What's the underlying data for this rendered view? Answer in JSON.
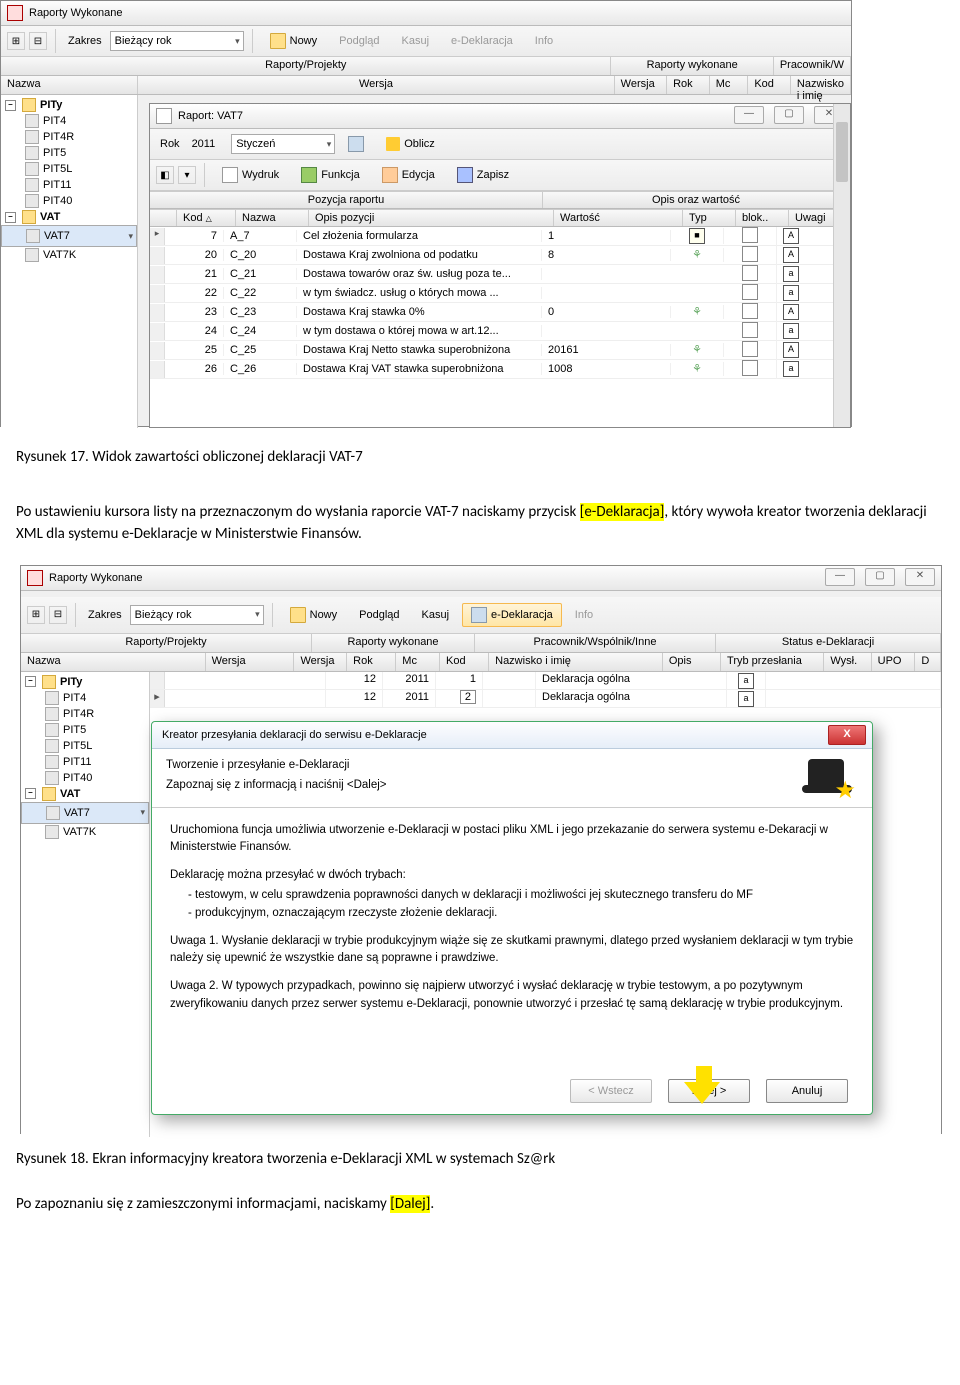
{
  "fig17": {
    "win_title": "Raporty Wykonane",
    "toolbar": {
      "zakres_label": "Zakres",
      "zakres_value": "Bieżący rok",
      "nowy": "Nowy",
      "podglad": "Podgląd",
      "kasuj": "Kasuj",
      "edekl": "e-Deklaracja",
      "info": "Info"
    },
    "header_groups": {
      "left": "Raporty/Projekty",
      "mid": "Raporty wykonane",
      "right": "Pracownik/W"
    },
    "header_cols": {
      "nazwa": "Nazwa",
      "wersja": "Wersja",
      "wersja2": "Wersja",
      "rok": "Rok",
      "mc": "Mc",
      "kod": "Kod",
      "nazwisko": "Nazwisko i imię"
    },
    "tree": {
      "pity": "PITy",
      "pit4": "PIT4",
      "pit4r": "PIT4R",
      "pit5": "PIT5",
      "pit5l": "PIT5L",
      "pit11": "PIT11",
      "pit40": "PIT40",
      "vat": "VAT",
      "vat7": "VAT7",
      "vat7k": "VAT7K"
    },
    "subwin": {
      "title": "Raport: VAT7",
      "rok_label": "Rok",
      "rok_value": "2011",
      "month": "Styczeń",
      "oblicz": "Oblicz",
      "wydruk": "Wydruk",
      "funkcja": "Funkcja",
      "edycja": "Edycja",
      "zapisz": "Zapisz",
      "group_left": "Pozycja raportu",
      "group_right": "Opis oraz wartość",
      "cols": {
        "kod": "Kod",
        "nazwa": "Nazwa",
        "opis": "Opis pozycji",
        "wartosc": "Wartość",
        "typ": "Typ",
        "blok": "blok..",
        "uwagi": "Uwagi"
      },
      "rows": [
        {
          "kod": "7",
          "nazwa": "A_7",
          "opis": "Cel złożenia formularza",
          "wartosc": "1",
          "typ": "doc",
          "a": "A"
        },
        {
          "kod": "20",
          "nazwa": "C_20",
          "opis": "Dostawa Kraj zwolniona od podatku",
          "wartosc": "8",
          "typ": "tree",
          "a": "A"
        },
        {
          "kod": "21",
          "nazwa": "C_21",
          "opis": "Dostawa towarów oraz św. usług poza te...",
          "wartosc": "",
          "typ": "",
          "a": "a"
        },
        {
          "kod": "22",
          "nazwa": "C_22",
          "opis": "   w tym świadcz. usług o których mowa ...",
          "wartosc": "",
          "typ": "",
          "a": "a"
        },
        {
          "kod": "23",
          "nazwa": "C_23",
          "opis": "Dostawa Kraj stawka 0%",
          "wartosc": "0",
          "typ": "tree",
          "a": "A"
        },
        {
          "kod": "24",
          "nazwa": "C_24",
          "opis": "   w tym dostawa o której mowa w art.12...",
          "wartosc": "",
          "typ": "",
          "a": "a"
        },
        {
          "kod": "25",
          "nazwa": "C_25",
          "opis": "Dostawa Kraj Netto stawka superobniżona",
          "wartosc": "20161",
          "typ": "tree",
          "a": "A"
        },
        {
          "kod": "26",
          "nazwa": "C_26",
          "opis": "Dostawa Kraj VAT stawka superobniżona",
          "wartosc": "1008",
          "typ": "tree",
          "a": "a"
        }
      ]
    }
  },
  "caption17": "Rysunek 17. Widok zawartości obliczonej deklaracji VAT-7",
  "para1_a": "Po ustawieniu kursora listy na przeznaczonym do wysłania raporcie VAT-7 naciskamy przycisk ",
  "para1_hl": "[e-Deklaracja]",
  "para1_b": ", który wywoła kreator tworzenia deklaracji XML dla systemu e-Deklaracje w Ministerstwie Finansów.",
  "fig18": {
    "win_title": "Raporty Wykonane",
    "toolbar": {
      "zakres_label": "Zakres",
      "zakres_value": "Bieżący rok",
      "nowy": "Nowy",
      "podglad": "Podgląd",
      "kasuj": "Kasuj",
      "edekl": "e-Deklaracja",
      "info": "Info"
    },
    "header_groups": {
      "g1": "Raporty/Projekty",
      "g2": "Raporty wykonane",
      "g3": "Pracownik/Wspólnik/Inne",
      "g4": "Status e-Deklaracji"
    },
    "header_cols": {
      "nazwa": "Nazwa",
      "wersja": "Wersja",
      "wersja2": "Wersja",
      "rok": "Rok",
      "mc": "Mc",
      "kod": "Kod",
      "nazwisko": "Nazwisko i imię",
      "opis": "Opis",
      "tryb": "Tryb przesłania",
      "wysl": "Wysł.",
      "upo": "UPO",
      "d": "D"
    },
    "tree": {
      "pity": "PITy",
      "pit4": "PIT4",
      "pit4r": "PIT4R",
      "pit5": "PIT5",
      "pit5l": "PIT5L",
      "pit11": "PIT11",
      "pit40": "PIT40",
      "vat": "VAT",
      "vat7": "VAT7",
      "vat7k": "VAT7K"
    },
    "rows": [
      {
        "wersja": "12",
        "rok": "2011",
        "mc": "1",
        "nazw": "Deklaracja ogólna"
      },
      {
        "wersja": "12",
        "rok": "2011",
        "mc": "2",
        "nazw": "Deklaracja ogólna"
      }
    ],
    "dialog": {
      "title": "Kreator przesyłania deklaracji do serwisu e-Deklaracje",
      "h1": "Tworzenie i przesyłanie e-Deklaracji",
      "h2": "Zapoznaj się z informacją i naciśnij <Dalej>",
      "p1": "Uruchomiona funcja umożliwia utworzenie e-Deklaracji w postaci pliku XML i jego przekazanie do serwera systemu e-Dekaracji w Ministerstwie Finansów.",
      "p2": "Deklarację można przesyłać w dwóch trybach:",
      "p2a": "- testowym,  w celu sprawdzenia poprawności danych w deklaracji i możliwości jej skutecznego transferu do MF",
      "p2b": "- produkcyjnym, oznaczającym rzeczyste złożenie deklaracji.",
      "p3": "Uwaga 1.  Wysłanie deklaracji w trybie produkcyjnym wiąże się ze skutkami prawnymi, dlatego przed wysłaniem deklaracji w tym trybie należy się upewnić że wszystkie dane są poprawne i prawdziwe.",
      "p4": "Uwaga 2.  W typowych przypadkach, powinno się najpierw utworzyć i wysłać deklarację w trybie testowym, a po pozytywnym zweryfikowaniu danych przez serwer systemu e-Deklaracji, ponownie utworzyć i przesłać tę samą deklarację w trybie produkcyjnym.",
      "btn_back": "< Wstecz",
      "btn_next": "Dalej >",
      "btn_cancel": "Anuluj"
    }
  },
  "caption18": "Rysunek 18. Ekran informacyjny kreatora tworzenia e-Deklaracji XML w systemach Sz@rk",
  "para2_a": "Po zapoznaniu się z zamieszczonymi informacjami, naciskamy ",
  "para2_hl": "[Dalej]",
  "para2_b": "."
}
